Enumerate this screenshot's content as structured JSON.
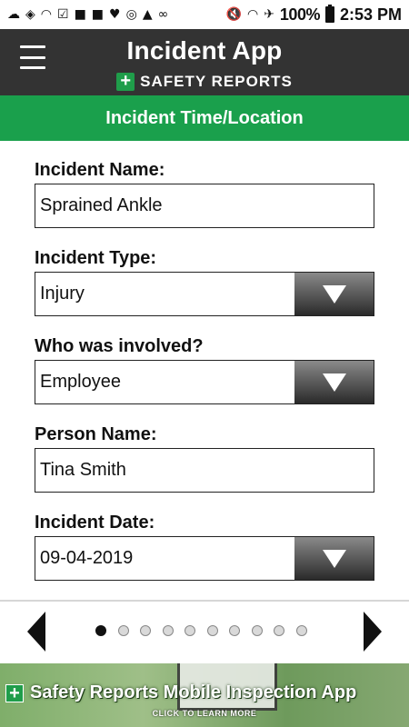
{
  "status_bar": {
    "left_icons": [
      "weather-icon",
      "vpn-icon",
      "wifi-icon",
      "checkbox-icon",
      "flipboard-icon",
      "flipboard-icon",
      "shield-icon",
      "sync-icon",
      "lock-wifi-icon",
      "voicemail-icon"
    ],
    "battery": "100%",
    "time": "2:53 PM"
  },
  "header": {
    "title": "Incident App",
    "brand": "SAFETY REPORTS",
    "brand_cross": "+"
  },
  "section": {
    "title": "Incident Time/Location"
  },
  "form": {
    "incident_name": {
      "label": "Incident Name:",
      "value": "Sprained Ankle"
    },
    "incident_type": {
      "label": "Incident Type:",
      "value": "Injury"
    },
    "who_involved": {
      "label": "Who was involved?",
      "value": "Employee"
    },
    "person_name": {
      "label": "Person Name:",
      "value": "Tina Smith"
    },
    "incident_date": {
      "label": "Incident Date:",
      "value": "09-04-2019"
    }
  },
  "pager": {
    "total_pages": 10,
    "current_page": 1
  },
  "banner": {
    "cross": "+",
    "title": "Safety Reports Mobile Inspection App",
    "cta": "CLICK TO LEARN MORE"
  },
  "colors": {
    "header_bg": "#333333",
    "accent_green": "#1aa04c",
    "text": "#111111"
  }
}
